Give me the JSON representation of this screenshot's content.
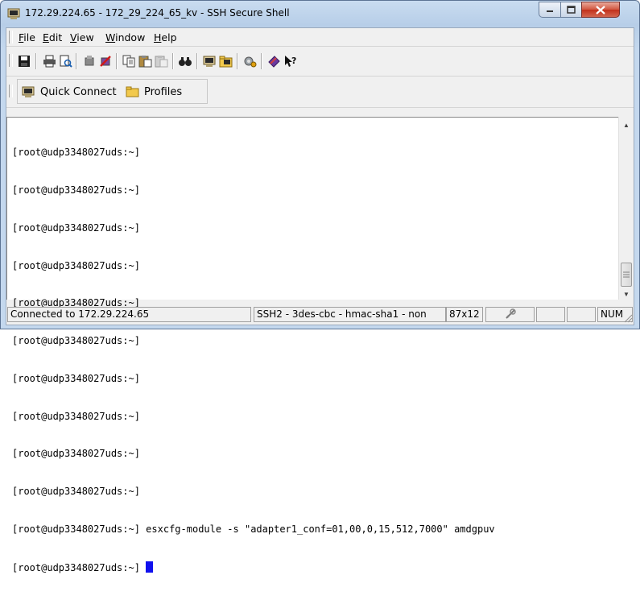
{
  "window": {
    "title": "172.29.224.65 - 172_29_224_65_kv - SSH Secure Shell",
    "icons": {
      "app": "ssh-terminal-icon",
      "minimize": "minimize-icon",
      "maximize": "maximize-icon",
      "close": "close-x-icon"
    }
  },
  "menu": {
    "items": [
      {
        "key": "F",
        "rest": "ile"
      },
      {
        "key": "E",
        "rest": "dit"
      },
      {
        "key": "V",
        "rest": "iew"
      },
      {
        "key": "W",
        "rest": "indow"
      },
      {
        "key": "H",
        "rest": "elp"
      }
    ]
  },
  "toolbar": {
    "buttons": [
      "save-icon",
      "print-icon",
      "print-preview-icon",
      "disconnect-icon",
      "close-session-icon",
      "copy-icon",
      "paste-icon",
      "paste-disabled-icon",
      "find-icon",
      "new-terminal-icon",
      "new-file-transfer-icon",
      "settings-icon",
      "profile-book-icon",
      "whats-this-help-icon"
    ]
  },
  "quickbar": {
    "quick_connect": "Quick Connect",
    "profiles": "Profiles"
  },
  "terminal": {
    "lines": [
      "[root@udp3348027uds:~]",
      "[root@udp3348027uds:~]",
      "[root@udp3348027uds:~]",
      "[root@udp3348027uds:~]",
      "[root@udp3348027uds:~]",
      "[root@udp3348027uds:~]",
      "[root@udp3348027uds:~]",
      "[root@udp3348027uds:~]",
      "[root@udp3348027uds:~]",
      "[root@udp3348027uds:~]",
      "[root@udp3348027uds:~] esxcfg-module -s \"adapter1_conf=01,00,0,15,512,7000\" amdgpuv"
    ],
    "prompt": "[root@udp3348027uds:~] ",
    "cursor_color": "#1010ee"
  },
  "status": {
    "connection": "Connected to 172.29.224.65",
    "cipher": "SSH2 - 3des-cbc - hmac-sha1 - non",
    "size": "87x12",
    "lock_icon": "encryption-icon",
    "numlock": "NUM"
  }
}
